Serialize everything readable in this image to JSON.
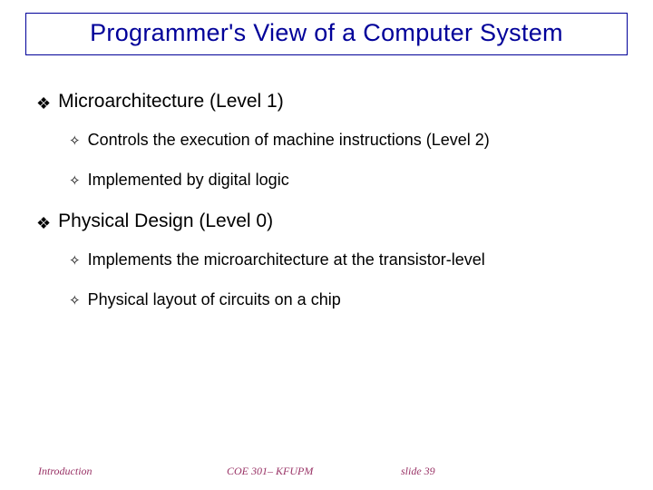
{
  "title": "Programmer's View of a Computer System",
  "bullets": [
    {
      "text": "Microarchitecture (Level 1)",
      "children": [
        "Controls the execution of machine instructions (Level 2)",
        "Implemented by digital logic"
      ]
    },
    {
      "text": "Physical Design (Level 0)",
      "children": [
        "Implements the microarchitecture at the transistor-level",
        "Physical layout of circuits on a chip"
      ]
    }
  ],
  "footer": {
    "left": "Introduction",
    "center": "COE 301– KFUPM",
    "right": "slide 39"
  }
}
